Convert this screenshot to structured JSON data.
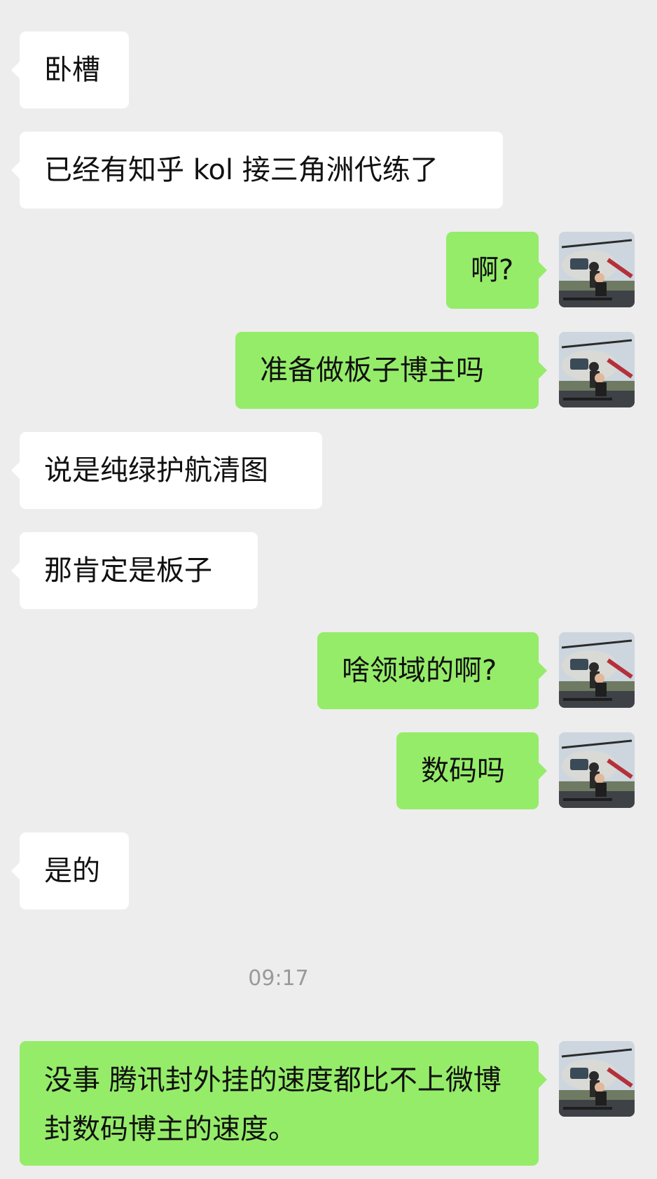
{
  "messages": [
    {
      "side": "left",
      "text": "卧槽"
    },
    {
      "side": "left",
      "text": "已经有知乎 kol 接三角洲代练了"
    },
    {
      "side": "right",
      "text": "啊?"
    },
    {
      "side": "right",
      "text": "准备做板子博主吗"
    },
    {
      "side": "left",
      "text": "说是纯绿护航清图"
    },
    {
      "side": "left",
      "text": "那肯定是板子"
    },
    {
      "side": "right",
      "text": "啥领域的啊?"
    },
    {
      "side": "right",
      "text": "数码吗"
    },
    {
      "side": "left",
      "text": "是的"
    },
    {
      "side": "right",
      "text": "没事 腾讯封外挂的速度都比不上微博封数码博主的速度。"
    }
  ],
  "timestamp": "09:17",
  "avatar": {
    "icon": "helicopter-photo-avatar"
  },
  "colors": {
    "background": "#ededed",
    "incoming_bubble": "#ffffff",
    "outgoing_bubble": "#95ec69",
    "timestamp_text": "#9a9a9a"
  }
}
